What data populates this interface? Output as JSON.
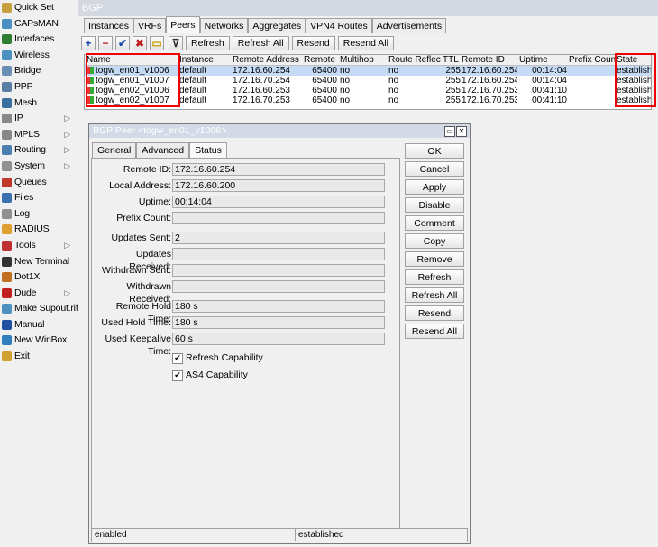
{
  "sidebar": {
    "items": [
      {
        "label": "Quick Set",
        "icon": "wand-icon",
        "color": "#c8a040",
        "arrow": false
      },
      {
        "label": "CAPsMAN",
        "icon": "capsman-icon",
        "color": "#4a90c0",
        "arrow": false
      },
      {
        "label": "Interfaces",
        "icon": "interfaces-icon",
        "color": "#2e7d32",
        "arrow": false
      },
      {
        "label": "Wireless",
        "icon": "wireless-icon",
        "color": "#4a90c0",
        "arrow": false
      },
      {
        "label": "Bridge",
        "icon": "bridge-icon",
        "color": "#6a8fb5",
        "arrow": false
      },
      {
        "label": "PPP",
        "icon": "ppp-icon",
        "color": "#5a7fa5",
        "arrow": false
      },
      {
        "label": "Mesh",
        "icon": "mesh-icon",
        "color": "#3a6fa0",
        "arrow": false
      },
      {
        "label": "IP",
        "icon": "ip-icon",
        "color": "#888888",
        "arrow": true
      },
      {
        "label": "MPLS",
        "icon": "mpls-icon",
        "color": "#888888",
        "arrow": true
      },
      {
        "label": "Routing",
        "icon": "routing-icon",
        "color": "#4a7fb0",
        "arrow": true
      },
      {
        "label": "System",
        "icon": "system-icon",
        "color": "#909090",
        "arrow": true
      },
      {
        "label": "Queues",
        "icon": "queues-icon",
        "color": "#c0392b",
        "arrow": false
      },
      {
        "label": "Files",
        "icon": "files-icon",
        "color": "#3a70b0",
        "arrow": false
      },
      {
        "label": "Log",
        "icon": "log-icon",
        "color": "#909090",
        "arrow": false
      },
      {
        "label": "RADIUS",
        "icon": "radius-icon",
        "color": "#e0a030",
        "arrow": false
      },
      {
        "label": "Tools",
        "icon": "tools-icon",
        "color": "#c03030",
        "arrow": true
      },
      {
        "label": "New Terminal",
        "icon": "terminal-icon",
        "color": "#333333",
        "arrow": false
      },
      {
        "label": "Dot1X",
        "icon": "dot1x-icon",
        "color": "#c07020",
        "arrow": false
      },
      {
        "label": "Dude",
        "icon": "dude-icon",
        "color": "#c02020",
        "arrow": true
      },
      {
        "label": "Make Supout.rif",
        "icon": "supout-icon",
        "color": "#4a90c0",
        "arrow": false
      },
      {
        "label": "Manual",
        "icon": "manual-icon",
        "color": "#2050a0",
        "arrow": false
      },
      {
        "label": "New WinBox",
        "icon": "winbox-icon",
        "color": "#3080c0",
        "arrow": false
      },
      {
        "label": "Exit",
        "icon": "exit-icon",
        "color": "#d0a030",
        "arrow": false
      }
    ]
  },
  "window": {
    "title": "BGP"
  },
  "tabs": [
    {
      "label": "Instances",
      "active": false
    },
    {
      "label": "VRFs",
      "active": false
    },
    {
      "label": "Peers",
      "active": true
    },
    {
      "label": "Networks",
      "active": false
    },
    {
      "label": "Aggregates",
      "active": false
    },
    {
      "label": "VPN4 Routes",
      "active": false
    },
    {
      "label": "Advertisements",
      "active": false
    }
  ],
  "toolbar": {
    "add_symbol": "+",
    "remove_symbol": "−",
    "enable_symbol": "✔",
    "disable_symbol": "✖",
    "comment_symbol": "▭",
    "filter_symbol": "⊽",
    "refresh": "Refresh",
    "refresh_all": "Refresh All",
    "resend": "Resend",
    "resend_all": "Resend All"
  },
  "table": {
    "columns": [
      "Name",
      "Instance",
      "Remote Address",
      "Remote AS",
      "Multihop",
      "Route Reflect",
      "TTL",
      "Remote ID",
      "Uptime",
      "Prefix Count",
      "State"
    ],
    "rows": [
      {
        "name": "togw_en01_v1006",
        "instance": "default",
        "remote_address": "172.16.60.254",
        "remote_as": "65400",
        "multihop": "no",
        "route_reflect": "no",
        "ttl": "255",
        "remote_id": "172.16.60.254",
        "uptime": "00:14:04",
        "prefix_count": "",
        "state": "established",
        "selected": true
      },
      {
        "name": "togw_en01_v1007",
        "instance": "default",
        "remote_address": "172.16.70.254",
        "remote_as": "65400",
        "multihop": "no",
        "route_reflect": "no",
        "ttl": "255",
        "remote_id": "172.16.60.254",
        "uptime": "00:14:04",
        "prefix_count": "",
        "state": "established",
        "selected": false
      },
      {
        "name": "togw_en02_v1006",
        "instance": "default",
        "remote_address": "172.16.60.253",
        "remote_as": "65400",
        "multihop": "no",
        "route_reflect": "no",
        "ttl": "255",
        "remote_id": "172.16.70.253",
        "uptime": "00:41:10",
        "prefix_count": "",
        "state": "established",
        "selected": false
      },
      {
        "name": "togw_en02_v1007",
        "instance": "default",
        "remote_address": "172.16.70.253",
        "remote_as": "65400",
        "multihop": "no",
        "route_reflect": "no",
        "ttl": "255",
        "remote_id": "172.16.70.253",
        "uptime": "00:41:10",
        "prefix_count": "",
        "state": "established",
        "selected": false
      }
    ]
  },
  "dialog": {
    "title": "BGP Peer <togw_en01_v1006>",
    "tabs": [
      {
        "label": "General",
        "active": false
      },
      {
        "label": "Advanced",
        "active": false
      },
      {
        "label": "Status",
        "active": true
      }
    ],
    "fields": [
      {
        "label": "Remote ID:",
        "value": "172.16.60.254"
      },
      {
        "label": "Local Address:",
        "value": "172.16.60.200"
      },
      {
        "label": "Uptime:",
        "value": "00:14:04"
      },
      {
        "label": "Prefix Count:",
        "value": ""
      },
      {
        "label": "Updates Sent:",
        "value": "2"
      },
      {
        "label": "Updates Received:",
        "value": ""
      },
      {
        "label": "Withdrawn Sent:",
        "value": ""
      },
      {
        "label": "Withdrawn Received:",
        "value": ""
      },
      {
        "label": "Remote Hold Time:",
        "value": "180 s"
      },
      {
        "label": "Used Hold Time:",
        "value": "180 s"
      },
      {
        "label": "Used Keepalive Time:",
        "value": "60 s"
      }
    ],
    "checkboxes": [
      {
        "label": "Refresh Capability",
        "checked": true
      },
      {
        "label": "AS4 Capability",
        "checked": true
      }
    ],
    "buttons": [
      "OK",
      "Cancel",
      "Apply",
      "Disable",
      "Comment",
      "Copy",
      "Remove",
      "Refresh",
      "Refresh All",
      "Resend",
      "Resend All"
    ],
    "status": {
      "left": "enabled",
      "right": "established"
    }
  }
}
